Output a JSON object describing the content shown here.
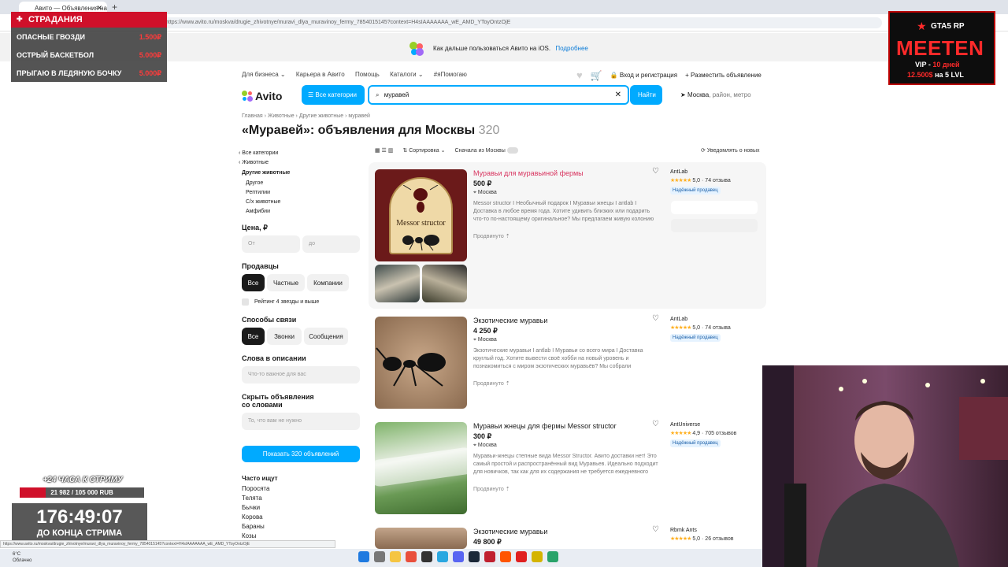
{
  "browser": {
    "tab_title": "Авито — Объявления на сайте",
    "tab_close": "✕",
    "new_tab": "+",
    "url": "https://www.avito.ru/moskva/drugie_zhivotnye/muravi_dlya_muravinoy_fermy_7854015145?context=H4sIAAAAAAA_wE_AMD_YToyOntzOjE"
  },
  "promo": {
    "text": "Как дальше пользоваться Авито на iOS.",
    "link": "Подробнее"
  },
  "topnav": {
    "items": [
      "Для бизнеса ⌄",
      "Карьера в Авито",
      "Помощь",
      "Каталоги ⌄",
      "#яПомогаю"
    ]
  },
  "rightnav": {
    "login": "Вход и регистрация",
    "post": "Разместить объявление"
  },
  "header": {
    "logo": "Avito",
    "all_categories": "Все категории",
    "search_value": "муравей",
    "find": "Найти",
    "location": "Москва",
    "location_hint": ", район, метро"
  },
  "breadcrumbs": "Главная › Животные › Другие животные › муравей",
  "title": {
    "text": "«Муравей»: объявления для Москвы",
    "count": "320"
  },
  "sidebar": {
    "cat_all": "‹ Все категории",
    "cat_animals": "‹ Животные",
    "cat_current": "Другие животные",
    "subcats": [
      "Другое",
      "Рептилии",
      "С/х животные",
      "Амфибии"
    ],
    "price_label": "Цена, ₽",
    "price_from": "От",
    "price_to": "до",
    "sellers_label": "Продавцы",
    "sellers": [
      "Все",
      "Частные",
      "Компании"
    ],
    "rating_label": "Рейтинг 4 звезды и выше",
    "contact_label": "Способы связи",
    "contacts": [
      "Все",
      "Звонки",
      "Сообщения"
    ],
    "words_label": "Слова в описании",
    "words_placeholder": "Что-то важное для вас",
    "hide_label_1": "Скрыть объявления",
    "hide_label_2": "со словами",
    "hide_placeholder": "То, что вам не нужно",
    "show_button": "Показать 320 объявлений",
    "often_label": "Часто ищут",
    "often": [
      "Поросята",
      "Телята",
      "Бычки",
      "Корова",
      "Бараны",
      "Козы"
    ]
  },
  "sortbar": {
    "sort": "⇅ Сортировка ⌄",
    "first_moscow": "Сначала из Москвы",
    "notify": "Уведомлять о новых"
  },
  "listings": [
    {
      "title": "Муравьи для муравьиной фермы",
      "price": "500 ₽",
      "city": "Москва",
      "desc": "Messor structor I Необычный подарок I Муравьи жнецы I antlab I Доставка в любое время года. Хотите удивить близких или подарить что-то по-настоящему оригинальное? Мы предлагаем живую колонию муравьёв Messor structor (муравьи-жнецы) —...",
      "promoted": "Продвинуто",
      "seller": "AntLab",
      "rating": "5,0 · 74 отзыва",
      "badge": "Надёжный продавец",
      "img_label": "Messor structor"
    },
    {
      "title": "Экзотические муравьи",
      "price": "4 250 ₽",
      "city": "Москва",
      "desc": "Экзотические муравьи I antlab I Муравьи со всего мира I Доставка круглый год. Хотите вывести своё хобби на новый уровень и познакомиться с миром экзотических муравьёв? Мы собрали уникальные виды со всех континентов — от азиатских...",
      "promoted": "Продвинуто",
      "seller": "AntLab",
      "rating": "5,0 · 74 отзыва",
      "badge": "Надёжный продавец"
    },
    {
      "title": "Муравьи жнецы для фермы Messor structor",
      "price": "300 ₽",
      "city": "Москва",
      "desc": "Муравьи-жнецы степные вида Messor Structor. Авито доставки нет! Это самый простой и распространённый вид Муравьев. Идеально подходит для новичков, так как для их содержания не требуется ежедневного кормления и уход сведен к минимуму...",
      "promoted": "Продвинуто",
      "seller": "AntUniverse",
      "rating": "4,9 · 705 отзывов",
      "badge": "Надёжный продавец"
    },
    {
      "title": "Экзотические муравьи",
      "price": "49 800 ₽",
      "seller": "Rbmk Ants",
      "rating": "5,0 · 26 отзывов"
    }
  ],
  "overlay": {
    "header": "СТРАДАНИЯ",
    "rows": [
      {
        "label": "ОПАСНЫЕ ГВОЗДИ",
        "price": "1.500₽"
      },
      {
        "label": "ОСТРЫЙ БАСКЕТБОЛ",
        "price": "5.000₽"
      },
      {
        "label": "ПРЫГАЮ В ЛЕДЯНУЮ БОЧКУ",
        "price": "5.000₽"
      }
    ]
  },
  "gta_ad": {
    "top": "GTA5 RP",
    "name": "MEETEN",
    "line1_a": "VIP -",
    "line1_b": "10 дней",
    "line2_a": "12.500$",
    "line2_b": "на 5 LVL"
  },
  "stream": {
    "goal_title": "+24 ЧАСА К СТРИМУ",
    "goal_value": "21 982 / 105 000 RUB",
    "goal_fraction": 0.209,
    "timer": "176:49:07",
    "timer_sub": "ДО КОНЦА СТРИМА"
  },
  "taskbar": {
    "temp": "6°C",
    "weather": "Облачно"
  },
  "colors": {
    "accent": "#00aaff",
    "hot_title": "#d8345f",
    "overlay_red": "#d0102a"
  }
}
